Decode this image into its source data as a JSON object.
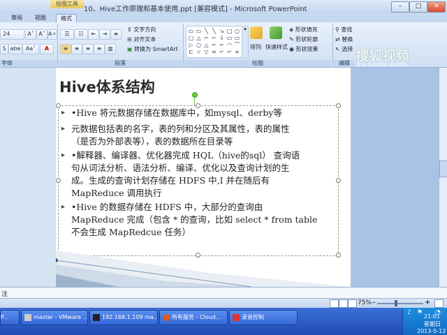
{
  "window": {
    "context_tab": "绘图工具",
    "title": "10、Hive工作原理和基本使用.ppt [兼容模式] - Microsoft PowerPoint",
    "minimize": "–",
    "maximize": "□",
    "close": "✕"
  },
  "tabs": [
    "审阅",
    "视图",
    "格式"
  ],
  "ribbon": {
    "font": {
      "size": "24",
      "grow": "A˄",
      "shrink": "A˅",
      "clear": "A✧",
      "bold": "S",
      "abc": "abe",
      "aa": "Aa˅",
      "color": "A",
      "label": "字体"
    },
    "paragraph": {
      "text_direction": "文字方向",
      "align_text": "对齐文本",
      "convert_smartart": "转换为 SmartArt",
      "label": "段落"
    },
    "drawing": {
      "shapes": [
        "▭",
        "▭",
        "╲",
        "╲",
        "↘",
        "□",
        "○",
        "□",
        "△",
        "⌐",
        "⌐",
        "⇩",
        "▭",
        "▭",
        "▷",
        "○",
        "△",
        "⌐",
        "⌐",
        "◠",
        "⌒",
        "⊏",
        "☆",
        "▽",
        "≈",
        "⌐",
        "⌐",
        "≈"
      ],
      "arrange": "排列",
      "quick_styles": "快速样式",
      "shape_fill": "形状填充",
      "shape_outline": "形状轮廓",
      "shape_effects": "形状效果",
      "label": "绘图"
    },
    "editing": {
      "find": "查找",
      "replace": "替换",
      "select": "选择",
      "label": "编辑"
    }
  },
  "watermark": {
    "line1": "搜狐视频",
    "line2": "tv.sohu.com"
  },
  "slide": {
    "title": "Hive体系结构",
    "bullets": [
      [
        "•Hive 将元数据存储在数据库中，如mysql、derby等"
      ],
      [
        "元数据包括表的名字，表的列和分区及其属性，表的属性",
        "（是否为外部表等），表的数据所在目录等"
      ],
      [
        "•解释器、编译器、优化器完成 HQL（hive的sql） 查询语",
        "句从词法分析、语法分析、编译、优化以及查询计划的生",
        "成。生成的查询计划存储在 HDFS 中,I 并在随后有",
        "MapReduce 调用执行"
      ],
      [
        "•Hive 的数据存储在 HDFS 中，大部分的查询由",
        "MapReduce 完成（包含 * 的查询，比如 select * from table",
        "不会生成 MapRedcue 任务）"
      ]
    ]
  },
  "notes": {
    "label": "注"
  },
  "statusbar": {
    "zoom": "75%",
    "minus": "–",
    "plus": "+"
  },
  "taskbar": {
    "items": [
      "P...",
      "master - VMware ...",
      "192.168.1.109 ma...",
      "所有服务 - Cloud...",
      "录音控制"
    ],
    "time": "21:01",
    "weekday": "星期日",
    "date": "2013-5-12"
  }
}
